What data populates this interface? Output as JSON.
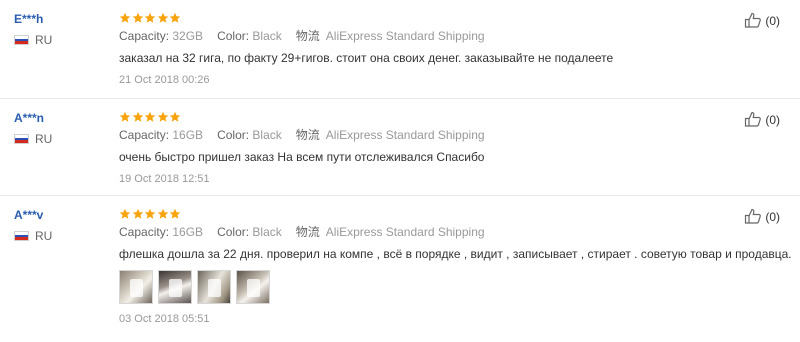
{
  "reviews": [
    {
      "username": "E***h",
      "country": "RU",
      "rating": 5,
      "capacity_label": "Capacity:",
      "capacity": "32GB",
      "color_label": "Color:",
      "color": "Black",
      "shipping_label": "物流",
      "shipping": "AliExpress Standard Shipping",
      "text": "заказал на 32 гига, по факту 29+гигов. стоит она своих денег. заказывайте не подалеете",
      "date": "21 Oct 2018 00:26",
      "helpful_count": "(0)",
      "photos": []
    },
    {
      "username": "A***n",
      "country": "RU",
      "rating": 5,
      "capacity_label": "Capacity:",
      "capacity": "16GB",
      "color_label": "Color:",
      "color": "Black",
      "shipping_label": "物流",
      "shipping": "AliExpress Standard Shipping",
      "text": "очень быстро пришел заказ На всем пути отслеживался Спасибо",
      "date": "19 Oct 2018 12:51",
      "helpful_count": "(0)",
      "photos": []
    },
    {
      "username": "A***v",
      "country": "RU",
      "rating": 5,
      "capacity_label": "Capacity:",
      "capacity": "16GB",
      "color_label": "Color:",
      "color": "Black",
      "shipping_label": "物流",
      "shipping": "AliExpress Standard Shipping",
      "text": "флешка дошла за 22 дня. проверил на компе , всё в порядке , видит , записывает , стирает . советую товар и продавца.",
      "date": "03 Oct 2018 05:51",
      "helpful_count": "(0)",
      "photos": [
        "photo-1",
        "photo-2",
        "photo-3",
        "photo-4"
      ]
    }
  ],
  "colors": {
    "star": "#f9a30d",
    "username": "#2a5db0",
    "muted": "#999999",
    "divider": "#e8e8e8"
  },
  "icons": {
    "rating": "star-icon",
    "helpful": "thumbs-up-icon",
    "flag": "russia-flag-icon"
  }
}
